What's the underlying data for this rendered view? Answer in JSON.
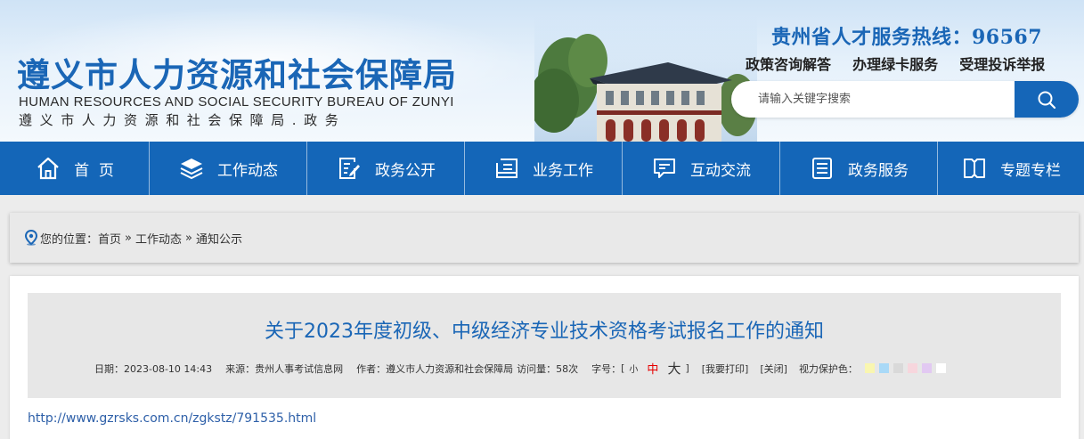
{
  "header": {
    "title": "遵义市人力资源和社会保障局",
    "title_en": "HUMAN RESOURCES AND SOCIAL SECURITY BUREAU OF ZUNYI",
    "subtitle": "遵义市人力资源和社会保障局.政务",
    "hotline": "贵州省人才服务热线：96567",
    "services": [
      "政策咨询解答",
      "办理绿卡服务",
      "受理投诉举报"
    ]
  },
  "search": {
    "placeholder": "请输入关键字搜索",
    "value": "",
    "icon": "search-icon"
  },
  "nav": {
    "items": [
      {
        "label": "首  页",
        "icon": "home-icon"
      },
      {
        "label": "工作动态",
        "icon": "layers-icon"
      },
      {
        "label": "政务公开",
        "icon": "document-edit-icon"
      },
      {
        "label": "业务工作",
        "icon": "briefcase-icon"
      },
      {
        "label": "互动交流",
        "icon": "chat-icon"
      },
      {
        "label": "政务服务",
        "icon": "list-icon"
      },
      {
        "label": "专题专栏",
        "icon": "book-icon"
      }
    ]
  },
  "breadcrumb": {
    "prefix": "您的位置：",
    "items": [
      "首页",
      "工作动态",
      "通知公示"
    ],
    "separator": "»"
  },
  "article": {
    "title": "关于2023年度初级、中级经济专业技术资格考试报名工作的通知",
    "meta": {
      "date": "日期：2023-08-10 14:43",
      "source": "来源：贵州人事考试信息网",
      "author": "作者：遵义市人力资源和社会保障局",
      "views": "访问量：58次",
      "font_label": "字号：",
      "bracket_open": "[",
      "bracket_close": "]",
      "font_small": "小",
      "font_mid": "中",
      "font_big": "大",
      "print": "[我要打印]",
      "close": "[关闭]",
      "eye_label": "视力保护色："
    },
    "swatch_colors": [
      "#f9f6b0",
      "#a9d9f7",
      "#d9d9d9",
      "#f7d6dd",
      "#e2c9f2",
      "#ffffff"
    ],
    "link": "http://www.gzrsks.com.cn/zgkstz/791535.html"
  },
  "colors": {
    "brand_blue": "#1466b8",
    "title_blue": "#1a66b6",
    "active_red": "#e60000"
  }
}
